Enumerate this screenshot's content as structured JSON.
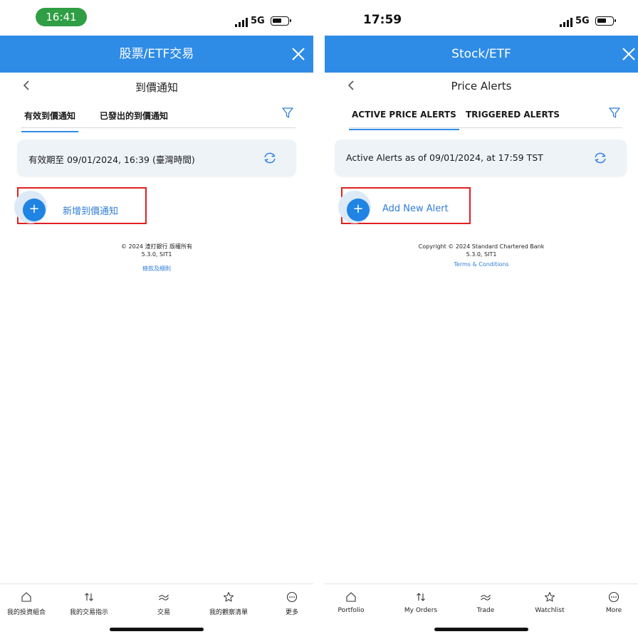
{
  "left": {
    "status": {
      "time": "16:41",
      "network": "5G"
    },
    "header": {
      "title": "股票/ETF交易"
    },
    "page_title": "到價通知",
    "tabs": [
      "有效到價通知",
      "已發出的到價通知"
    ],
    "card_text": "有效期至 09/01/2024, 16:39 (臺灣時間)",
    "add_label": "新增到價通知",
    "footer": {
      "copyright": "© 2024 渣打銀行 版權所有",
      "version": "5.3.0, SIT1",
      "terms": "條款及細則"
    },
    "nav": [
      "我的投資組合",
      "我的交易指示",
      "交易",
      "我的觀察清單",
      "更多"
    ]
  },
  "right": {
    "status": {
      "time": "17:59",
      "network": "5G"
    },
    "header": {
      "title": "Stock/ETF"
    },
    "page_title": "Price Alerts",
    "tabs": [
      "ACTIVE PRICE ALERTS",
      "TRIGGERED ALERTS"
    ],
    "card_text": "Active Alerts as of 09/01/2024, at 17:59 TST",
    "add_label": "Add New Alert",
    "footer": {
      "copyright": "Copyright © 2024 Standard Chartered Bank",
      "version": "5.3.0, SIT1",
      "terms": "Terms & Conditions"
    },
    "nav": [
      "Portfolio",
      "My Orders",
      "Trade",
      "Watchlist",
      "More"
    ]
  },
  "colors": {
    "header": "#2f8ce6",
    "accent": "#1f84e3",
    "highlight_box": "#e02020",
    "time_pill": "#2f9e44"
  },
  "icons": [
    "close-icon",
    "back-chevron-icon",
    "filter-icon",
    "refresh-icon",
    "plus-icon",
    "home-icon",
    "orders-icon",
    "trade-icon",
    "star-icon",
    "more-icon"
  ]
}
